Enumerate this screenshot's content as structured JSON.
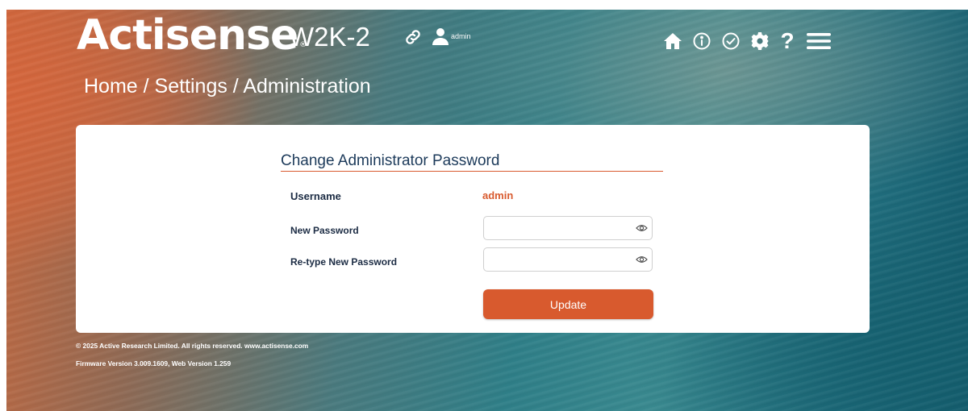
{
  "header": {
    "brand": "Actisense",
    "brand_mark": "®",
    "model": "W2K-2",
    "user": "admin",
    "icons": [
      "link-icon",
      "user-icon",
      "home-icon",
      "info-icon",
      "check-circle-icon",
      "gear-icon",
      "help-icon",
      "menu-icon"
    ],
    "help_glyph": "?"
  },
  "breadcrumb": "Home / Settings / Administration",
  "form": {
    "title": "Change Administrator Password",
    "username_label": "Username",
    "username_value": "admin",
    "new_password_label": "New Password",
    "new_password_value": "",
    "retype_password_label": "Re-type New Password",
    "retype_password_value": "",
    "update_label": "Update"
  },
  "footer": {
    "copyright": "© 2025 Active Research Limited. All rights reserved.  www.actisense.com",
    "version": "Firmware Version 3.009.1609, Web Version 1.259"
  },
  "colors": {
    "accent": "#d85a2e",
    "title": "#1c3a5a",
    "card": "#ffffff"
  }
}
